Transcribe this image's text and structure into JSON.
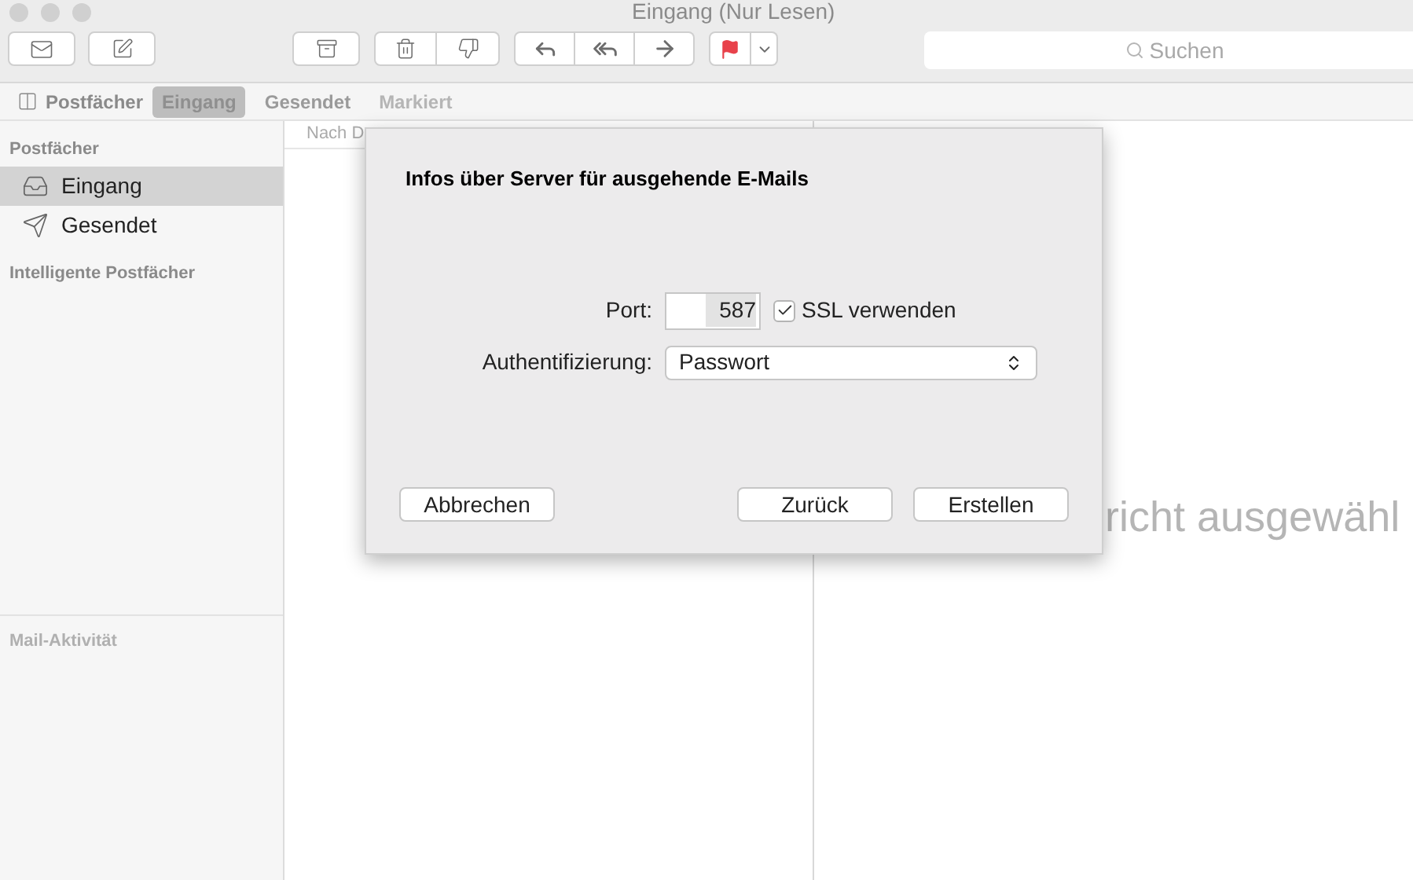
{
  "window": {
    "title": "Eingang (Nur Lesen)"
  },
  "search": {
    "placeholder": "Suchen"
  },
  "favorites_bar": {
    "mailboxes_label": "Postfächer",
    "items": [
      {
        "label": "Eingang",
        "selected": true,
        "disabled": false
      },
      {
        "label": "Gesendet",
        "selected": false,
        "disabled": false
      },
      {
        "label": "Markiert",
        "selected": false,
        "disabled": true
      }
    ]
  },
  "sidebar": {
    "heading": "Postfächer",
    "items": [
      {
        "label": "Eingang",
        "kind": "inbox",
        "selected": true
      },
      {
        "label": "Gesendet",
        "kind": "sent",
        "selected": false
      }
    ],
    "smart_heading": "Intelligente Postfächer",
    "activity_heading": "Mail-Aktivität"
  },
  "message_list": {
    "sort_label": "Nach D"
  },
  "viewer": {
    "empty_text": "richt ausgewähl"
  },
  "dialog": {
    "title": "Infos über Server für ausgehende E-Mails",
    "port_label": "Port:",
    "port_value": "587",
    "ssl": {
      "label": "SSL verwenden",
      "checked": true
    },
    "auth_label": "Authentifizierung:",
    "auth_value": "Passwort",
    "buttons": [
      "Abbrechen",
      "Zurück",
      "Erstellen"
    ]
  }
}
